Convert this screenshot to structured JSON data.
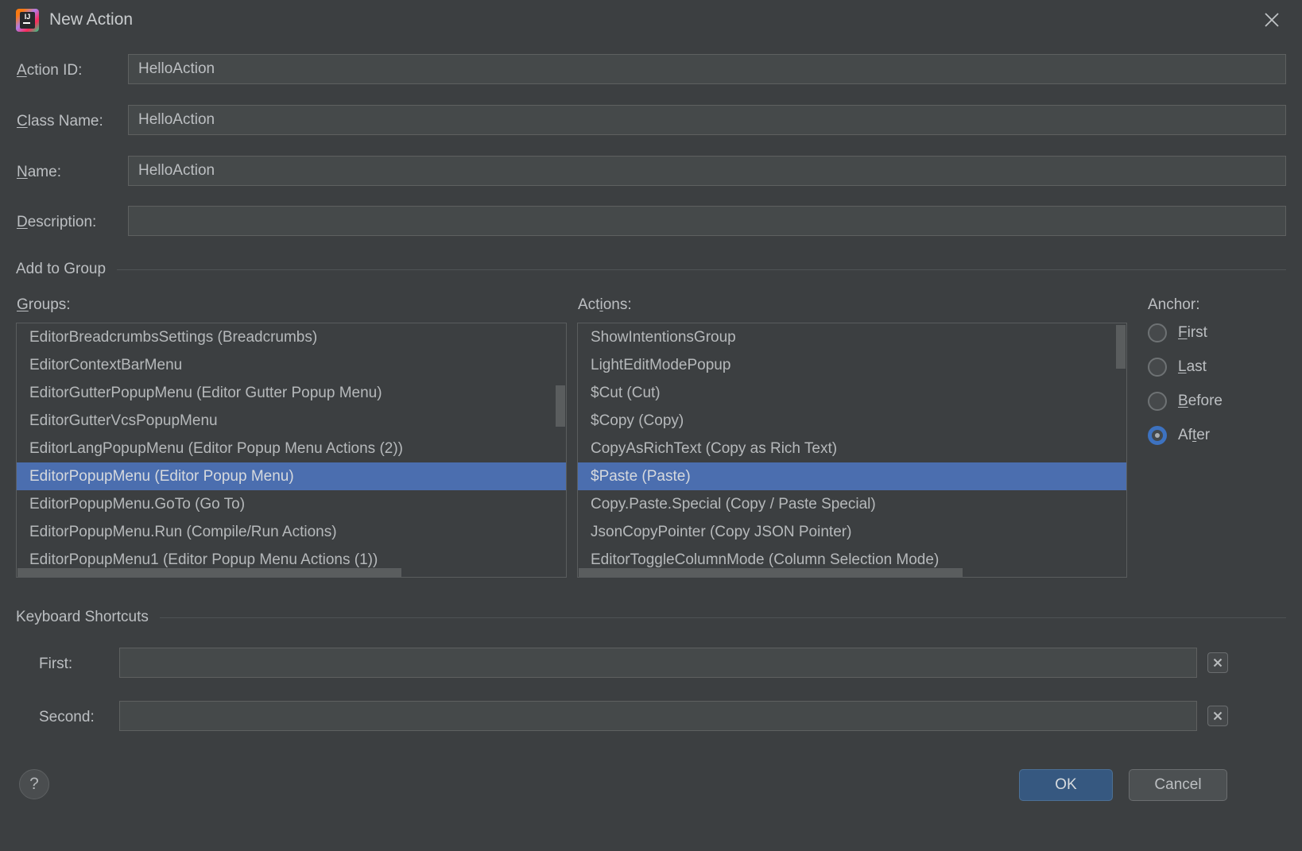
{
  "window": {
    "title": "New Action",
    "app_icon": "intellij-idea-icon",
    "close_label": "×"
  },
  "form": {
    "fields": [
      {
        "label_prefix": "",
        "mnemonic": "A",
        "label_rest": "ction ID:",
        "value": "HelloAction",
        "placeholder": "",
        "name": "action-id"
      },
      {
        "label_prefix": "",
        "mnemonic": "C",
        "label_rest": "lass Name:",
        "value": "HelloAction",
        "placeholder": "",
        "name": "class-name"
      },
      {
        "label_prefix": "",
        "mnemonic": "N",
        "label_rest": "ame:",
        "value": "HelloAction",
        "placeholder": "",
        "name": "name"
      },
      {
        "label_prefix": "",
        "mnemonic": "D",
        "label_rest": "escription:",
        "value": "",
        "placeholder": "",
        "name": "description"
      }
    ]
  },
  "add_to_group": {
    "section_title": "Add to Group",
    "groups": {
      "label_mnemonic": "G",
      "label_rest": "roups:",
      "items": [
        "EditorBreadcrumbsSettings (Breadcrumbs)",
        "EditorContextBarMenu",
        "EditorGutterPopupMenu (Editor Gutter Popup Menu)",
        "EditorGutterVcsPopupMenu",
        "EditorLangPopupMenu (Editor Popup Menu Actions (2))",
        "EditorPopupMenu (Editor Popup Menu)",
        "EditorPopupMenu.GoTo (Go To)",
        "EditorPopupMenu.Run (Compile/Run Actions)",
        "EditorPopupMenu1 (Editor Popup Menu Actions (1))"
      ],
      "selected_index": 5
    },
    "actions": {
      "label_prefix": "Act",
      "label_mnemonic": "i",
      "label_rest": "ons:",
      "items": [
        "ShowIntentionsGroup",
        "LightEditModePopup",
        "$Cut (Cut)",
        "$Copy (Copy)",
        "CopyAsRichText (Copy as Rich Text)",
        "$Paste (Paste)",
        "Copy.Paste.Special (Copy / Paste Special)",
        "JsonCopyPointer (Copy JSON Pointer)",
        "EditorToggleColumnMode (Column Selection Mode)"
      ],
      "selected_index": 5
    },
    "anchor": {
      "label": "Anchor:",
      "options": [
        {
          "mnemonic": "F",
          "rest": "irst",
          "checked": false,
          "name": "anchor-first"
        },
        {
          "prefix": "",
          "mnemonic": "L",
          "rest": "ast",
          "checked": false,
          "name": "anchor-last"
        },
        {
          "prefix": "",
          "mnemonic": "B",
          "rest": "efore",
          "checked": false,
          "name": "anchor-before"
        },
        {
          "prefix": "Af",
          "mnemonic": "t",
          "rest": "er",
          "checked": true,
          "name": "anchor-after"
        }
      ],
      "selected": "After"
    }
  },
  "keyboard_shortcuts": {
    "section_title": "Keyboard Shortcuts",
    "first": {
      "label": "First:",
      "value": "",
      "placeholder": "",
      "clear_icon": "close-icon"
    },
    "second": {
      "label": "Second:",
      "value": "",
      "placeholder": "",
      "clear_icon": "close-icon"
    }
  },
  "footer": {
    "help_label": "?",
    "ok_label": "OK",
    "cancel_label": "Cancel"
  },
  "colors": {
    "selection": "#4b6eaf",
    "primary_button": "#365880",
    "radio_accent": "#3d72c0",
    "background": "#3c3f41",
    "field_background": "#45494a"
  }
}
